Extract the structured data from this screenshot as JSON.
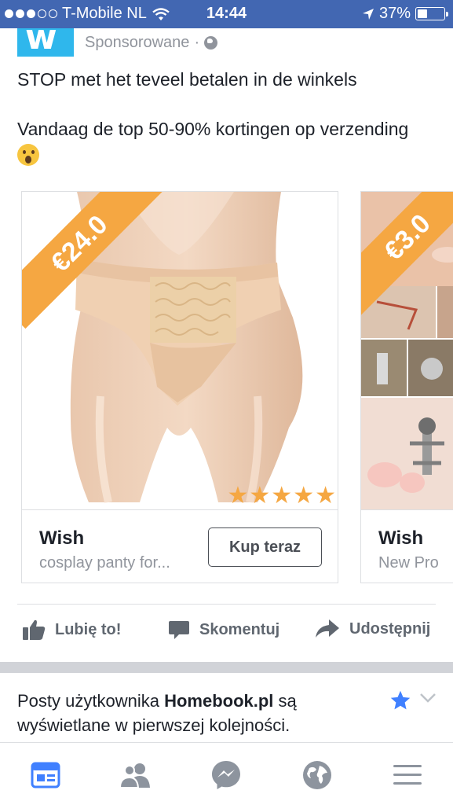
{
  "status_bar": {
    "carrier": "T-Mobile NL",
    "time": "14:44",
    "battery": "37%",
    "signal_dots_filled": 3,
    "signal_dots_total": 5
  },
  "post": {
    "advertiser_logo_letter": "w",
    "sponsored_label": "Sponsorowane",
    "separator": "·",
    "text_line1": "STOP met het teveel betalen in de winkels",
    "text_line2": "Vandaag de top 50-90% kortingen op verzending"
  },
  "carousel": [
    {
      "price": "€24.0",
      "store": "Wish",
      "description": "cosplay panty for...",
      "cta": "Kup teraz",
      "rating_stars": 5
    },
    {
      "price": "€3.0",
      "store": "Wish",
      "description": "New Pro"
    }
  ],
  "actions": {
    "like": "Lubię to!",
    "comment": "Skomentuj",
    "share": "Udostępnij"
  },
  "notice": {
    "prefix": "Posty użytkownika ",
    "page_name": "Homebook.pl",
    "suffix": " są wyświetlane w pierwszej kolejności."
  },
  "colors": {
    "brand_blue": "#4267b2",
    "price_orange": "#f5a742",
    "wish_blue": "#2fb7ec",
    "text_gray": "#90949c",
    "active_tab": "#4080ff"
  },
  "tabs": [
    "news-feed-icon",
    "friends-icon",
    "messenger-icon",
    "notifications-globe-icon",
    "menu-icon"
  ]
}
